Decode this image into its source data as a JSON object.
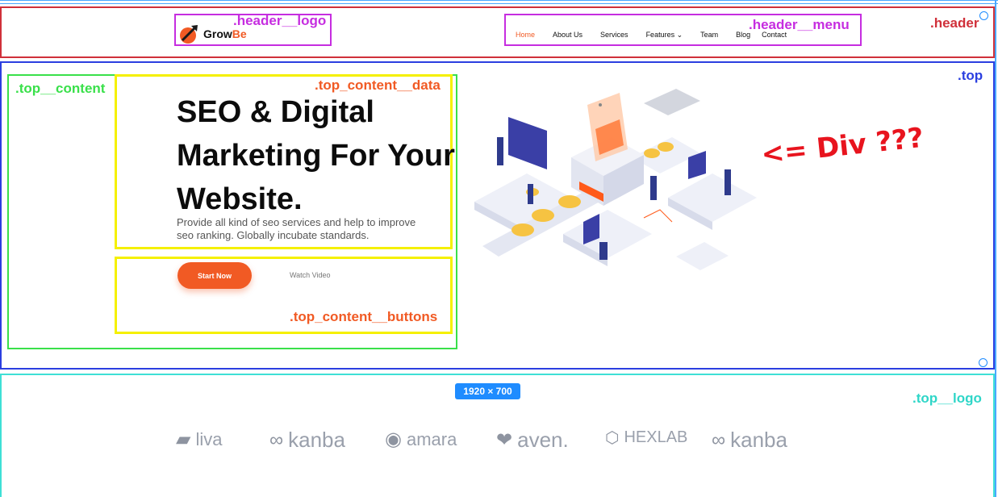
{
  "labels": {
    "header_logo": ".header__logo",
    "header_menu": ".header__menu",
    "header": ".header",
    "top": ".top",
    "top_content": ".top__content",
    "top_content_data": ".top_content__data",
    "top_content_buttons": ".top_content__buttons",
    "top_logo": ".top__logo",
    "div_question": "<= Div ???"
  },
  "logo": {
    "part1": "Grow",
    "part2": "Be"
  },
  "menu": [
    "Home",
    "About Us",
    "Services",
    "Features ⌄",
    "Team",
    "Blog",
    "Contact"
  ],
  "hero": {
    "title": "SEO & Digital Marketing For Your Website.",
    "text": "Provide all kind of seo services and help to improve seo ranking. Globally incubate standards."
  },
  "buttons": {
    "start": "Start Now",
    "video": "Watch Video"
  },
  "size_badge": "1920 × 700",
  "brands": [
    {
      "name": "liva",
      "icon": "liva-icon"
    },
    {
      "name": "kanba",
      "icon": "kanba-icon"
    },
    {
      "name": "amara",
      "icon": "amara-icon"
    },
    {
      "name": "aven.",
      "icon": "aven-icon"
    },
    {
      "name": "HEXLAB",
      "icon": "hexlab-icon"
    },
    {
      "name": "kanba",
      "icon": "kanba-icon"
    }
  ],
  "colors": {
    "accent": "#f15a24",
    "header_outline": "#d0303a",
    "top_outline": "#2b3fe0",
    "content_outline": "#39e04a",
    "data_outline": "#f5f000",
    "logo_outline": "#c62de0",
    "toplogo_outline": "#3fe0d6"
  }
}
